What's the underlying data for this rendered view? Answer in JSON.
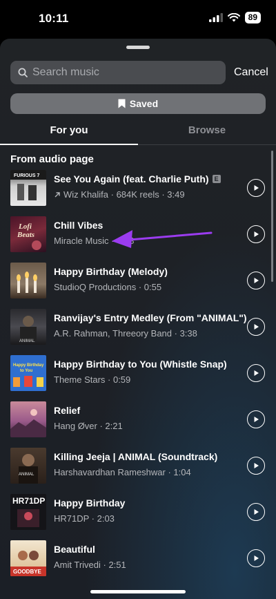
{
  "status": {
    "time": "10:11",
    "battery": "89"
  },
  "search": {
    "placeholder": "Search music",
    "cancel": "Cancel"
  },
  "saved": {
    "label": "Saved"
  },
  "tabs": {
    "for_you": "For you",
    "browse": "Browse"
  },
  "section": {
    "title": "From audio page"
  },
  "tracks": [
    {
      "title": "See You Again (feat. Charlie Puth)",
      "explicit": "E",
      "subtitle": "Wiz Khalifa · 684K reels · 3:49",
      "trending_icon": "arrow-up-right-icon"
    },
    {
      "title": "Chill Vibes",
      "subtitle": "Miracle Music · 4:48"
    },
    {
      "title": "Happy Birthday (Melody)",
      "subtitle": "StudioQ Productions · 0:55"
    },
    {
      "title": "Ranvijay's Entry Medley (From \"ANIMAL\")",
      "subtitle": "A.R. Rahman, Threeory Band · 3:38"
    },
    {
      "title": "Happy Birthday to You (Whistle Snap)",
      "subtitle": "Theme Stars · 0:59"
    },
    {
      "title": "Relief",
      "subtitle": "Hang Øver · 2:21"
    },
    {
      "title": "Killing Jeeja | ANIMAL (Soundtrack)",
      "subtitle": "Harshavardhan Rameshwar · 1:04"
    },
    {
      "title": "Happy Birthday",
      "subtitle": "HR71DP · 2:03"
    },
    {
      "title": "Beautiful",
      "subtitle": "Amit Trivedi · 2:51"
    }
  ],
  "thumbnail_text": {
    "t1": "FURIOUS 7",
    "t2_a": "Lofi",
    "t2_b": "Beats",
    "t4": "ANIMAL",
    "t5_a": "Happy Birthday",
    "t5_b": "to You",
    "t7": "ANIMAL",
    "t8": "HR71DP",
    "t9": "GOODBYE"
  },
  "colors": {
    "annotation_arrow": "#9b3cf0",
    "sheet_background": "#1e2126",
    "accent": "#ffffff"
  }
}
